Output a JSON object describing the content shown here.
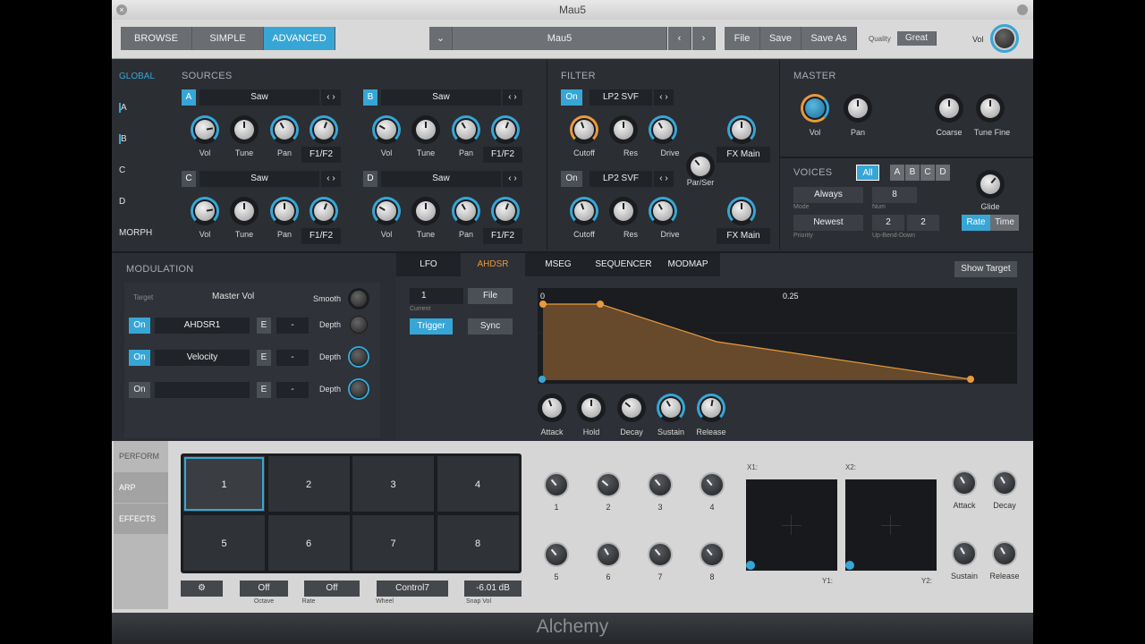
{
  "window": {
    "title": "Mau5",
    "footer": "Alchemy"
  },
  "top": {
    "modes": [
      "BROWSE",
      "SIMPLE",
      "ADVANCED"
    ],
    "preset": "Mau5",
    "file": "File",
    "save": "Save",
    "save_as": "Save As",
    "quality_label": "Quality",
    "quality": "Great",
    "vol": "Vol"
  },
  "sidebar": [
    "GLOBAL",
    "A",
    "B",
    "C",
    "D",
    "MORPH"
  ],
  "sources": {
    "title": "SOURCES",
    "cells": [
      {
        "id": "A",
        "wave": "Saw"
      },
      {
        "id": "B",
        "wave": "Saw"
      },
      {
        "id": "C",
        "wave": "Saw"
      },
      {
        "id": "D",
        "wave": "Saw"
      }
    ],
    "knobs": [
      "Vol",
      "Tune",
      "Pan"
    ],
    "filt": "F1/F2"
  },
  "filter": {
    "title": "FILTER",
    "on": "On",
    "type": "LP2 SVF",
    "knobs": [
      "Cutoff",
      "Res",
      "Drive"
    ],
    "fx": "FX Main",
    "parser": "Par/Ser"
  },
  "master": {
    "title": "MASTER",
    "vol": "Vol",
    "pan": "Pan",
    "coarse": "Coarse",
    "tune_fine": "Tune Fine"
  },
  "voices": {
    "title": "VOICES",
    "all": "All",
    "letters": [
      "A",
      "B",
      "C",
      "D"
    ],
    "mode": "Always",
    "mode_lbl": "Mode",
    "num": "8",
    "num_lbl": "Num",
    "priority": "Newest",
    "priority_lbl": "Priority",
    "bend1": "2",
    "bend2": "2",
    "bend_lbl": "Up-Bend-Down",
    "glide": "Glide",
    "rate": "Rate",
    "time": "Time"
  },
  "mod": {
    "title": "MODULATION",
    "target_lbl": "Target",
    "target": "Master Vol",
    "smooth": "Smooth",
    "rows": [
      {
        "on": "On",
        "src": "AHDSR1",
        "e": "E",
        "d": "-",
        "depth": "Depth"
      },
      {
        "on": "On",
        "src": "Velocity",
        "e": "E",
        "d": "-",
        "depth": "Depth"
      },
      {
        "on": "On",
        "src": "",
        "e": "E",
        "d": "-",
        "depth": "Depth"
      }
    ]
  },
  "tabs": [
    "LFO",
    "AHDSR",
    "MSEG",
    "SEQUENCER",
    "MODMAP"
  ],
  "env": {
    "show_target": "Show Target",
    "current": "1",
    "current_lbl": "Current",
    "file": "File",
    "trigger": "Trigger",
    "sync": "Sync",
    "t0": "0",
    "t1": "0.25",
    "knobs": [
      "Attack",
      "Hold",
      "Decay",
      "Sustain",
      "Release"
    ]
  },
  "perform": {
    "tabs": [
      "PERFORM",
      "ARP",
      "EFFECTS"
    ],
    "pads": [
      "1",
      "2",
      "3",
      "4",
      "5",
      "6",
      "7",
      "8"
    ],
    "octave": "Off",
    "octave_lbl": "Octave",
    "rate": "Off",
    "rate_lbl": "Rate",
    "wheel": "Control7",
    "wheel_lbl": "Wheel",
    "snap": "-6.01 dB",
    "snap_lbl": "Snap Vol",
    "knobs": [
      "1",
      "2",
      "3",
      "4",
      "5",
      "6",
      "7",
      "8"
    ],
    "x1": "X1:",
    "y1": "Y1:",
    "x2": "X2:",
    "y2": "Y2:",
    "env": [
      "Attack",
      "Decay",
      "Sustain",
      "Release"
    ]
  },
  "colors": {
    "accent": "#37a6d6",
    "orange": "#e89a3c"
  }
}
